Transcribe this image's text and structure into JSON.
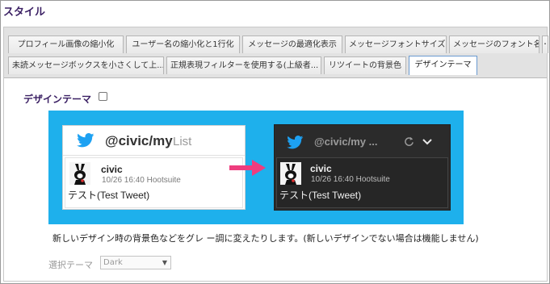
{
  "page": {
    "title": "スタイル"
  },
  "tabs": {
    "row1": [
      {
        "label": "プロフィール画像の縮小化"
      },
      {
        "label": "ユーザー名の縮小化と1行化"
      },
      {
        "label": "メッセージの最適化表示"
      },
      {
        "label": "メッセージフォントサイズ"
      },
      {
        "label": "メッセージのフォント名"
      },
      {
        "label": "･"
      }
    ],
    "row2": [
      {
        "label": "未読メッセージボックスを小さくして上..."
      },
      {
        "label": "正規表現フィルターを使用する(上級者..."
      },
      {
        "label": "リツイートの背景色"
      },
      {
        "label": "デザインテーマ",
        "active": true
      }
    ]
  },
  "section": {
    "label": "デザインテーマ",
    "checked": false
  },
  "preview": {
    "background_color": "#1eb0ec",
    "light": {
      "account": "@civic/my",
      "list_word": "List",
      "user": "civic",
      "meta": "10/26 16:40 Hootsuite",
      "text": "テスト(Test Tweet)"
    },
    "dark": {
      "account": "@civic/my ...",
      "user": "civic",
      "meta": "10/26 16:40 Hootsuite",
      "text": "テスト(Test Tweet)"
    },
    "arrow_color": "#ee3d7e",
    "twitter_blue": "#1da1f2"
  },
  "description": "新しいデザイン時の背景色などをグレ ー調に変えたりします。(新しいデザインでない場合は機能しません)",
  "theme_select": {
    "label": "選択テーマ",
    "value": "Dark"
  }
}
